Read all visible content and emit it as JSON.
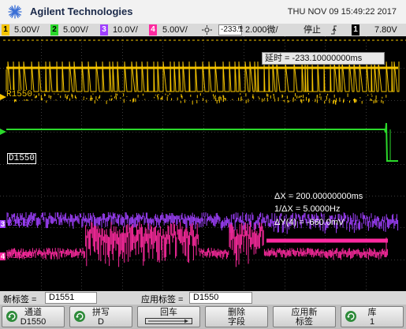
{
  "header": {
    "brand": "Agilent Technologies",
    "datetime": "THU NOV 09 15:49:22 2017"
  },
  "status": {
    "ch1": {
      "num": "1",
      "scale": "5.00V/",
      "color": "#f5c400"
    },
    "ch2": {
      "num": "2",
      "scale": "5.00V/",
      "color": "#2bd92b"
    },
    "ch3": {
      "num": "3",
      "scale": "10.0V/",
      "color": "#a040ff"
    },
    "ch4": {
      "num": "4",
      "scale": "5.00V/",
      "color": "#ff2aa0"
    },
    "delay": "-233.1",
    "delay_unit": "m",
    "timebase": "2.000微/",
    "run_state": "停止",
    "trigger_ch": "1",
    "trigger_level": "7.80V"
  },
  "display": {
    "delay_readout": "延时 = -233.10000000ms",
    "labels": {
      "r": "R1550",
      "d": "D1550",
      "b": "B1550",
      "a": "A1550",
      "r_marker": "R",
      "b_marker": "3",
      "a_marker": "4"
    },
    "cursor": {
      "dx": "ΔX = 200.00000000ms",
      "inv_dx": "1/ΔX = 5.0000Hz",
      "dy": "ΔY(4) = -660.0mV"
    },
    "colors": {
      "yellow": "#f5c400",
      "green": "#2bd92b",
      "purple": "#a040ff",
      "pink": "#ff2aa0"
    }
  },
  "labels_row": {
    "new_label_caption": "新标签 = ",
    "new_label_value": "D1551",
    "applied_label_caption": "应用标签 = ",
    "applied_label_value": "D1550"
  },
  "softkeys": [
    {
      "line1": "通道",
      "line2": "D1550"
    },
    {
      "line1": "拼写",
      "line2": "D"
    },
    {
      "line1": "回车",
      "line2": ""
    },
    {
      "line1": "删除",
      "line2": "字段"
    },
    {
      "line1": "应用新",
      "line2": "标签"
    },
    {
      "line1": "库",
      "line2": "1"
    }
  ]
}
